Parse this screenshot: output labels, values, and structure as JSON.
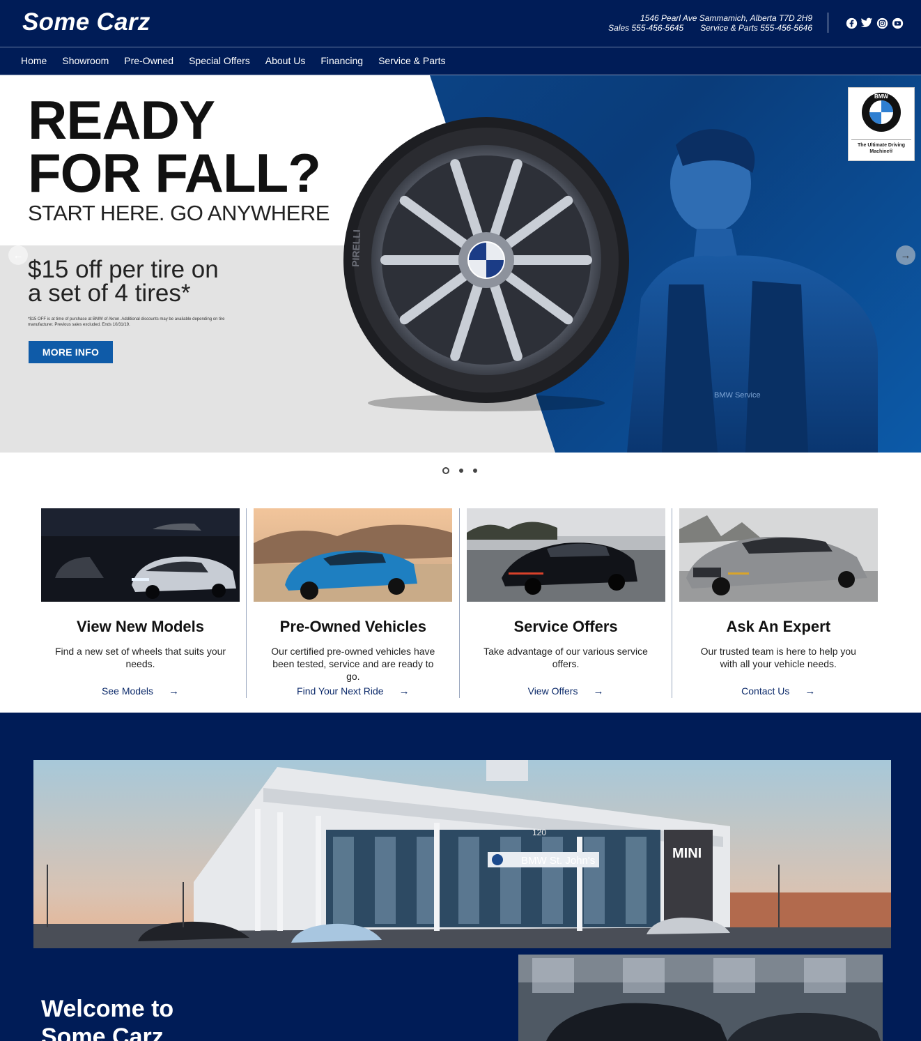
{
  "header": {
    "logo": "Some Carz",
    "address": "1546 Pearl Ave Sammamich, Alberta T7D 2H9",
    "sales": "Sales 555-456-5645",
    "service": "Service & Parts 555-456-5646",
    "social": [
      "facebook-icon",
      "twitter-icon",
      "instagram-icon",
      "youtube-icon"
    ]
  },
  "nav": {
    "items": [
      "Home",
      "Showroom",
      "Pre-Owned",
      "Special Offers",
      "About Us",
      "Financing",
      "Service & Parts"
    ]
  },
  "hero": {
    "headline_1": "READY",
    "headline_2": "FOR FALL?",
    "subheadline": "START HERE. GO ANYWHERE",
    "offer_1": "$15 off per tire on",
    "offer_2": "a set of 4 tires*",
    "fine_print": "*$15 OFF is at time of purchase at BMW of Akron. Additional discounts may be available depending on tire manufacturer. Previous sales excluded. Ends 10/31/19.",
    "button": "MORE INFO",
    "badge_tag": "The Ultimate Driving Machine®",
    "badge_brand": "BMW",
    "tire_brand": "PIRELLI",
    "mechanic_label": "BMW Service",
    "slide_count": 3,
    "active_slide": 1
  },
  "cards": [
    {
      "title": "View New Models",
      "text": "Find a new set of wheels that suits your needs.",
      "link": "See Models"
    },
    {
      "title": "Pre-Owned Vehicles",
      "text": "Our certified pre-owned vehicles have been tested, service and are ready to go.",
      "link": "Find Your Next Ride"
    },
    {
      "title": "Service Offers",
      "text": "Take advantage of our various service offers.",
      "link": "View Offers"
    },
    {
      "title": "Ask An Expert",
      "text": "Our trusted team is here to help you with all your vehicle needs.",
      "link": "Contact Us"
    }
  ],
  "dealer": {
    "welcome_1": "Welcome to",
    "welcome_2": "Some Carz",
    "building_sign": "BMW St. John's",
    "mini_sign": "MINI",
    "building_number": "120"
  },
  "colors": {
    "navy": "#001c57",
    "hero_blue": "#0d4c94",
    "button_blue": "#0f5ba8",
    "link": "#0c2a6a"
  }
}
